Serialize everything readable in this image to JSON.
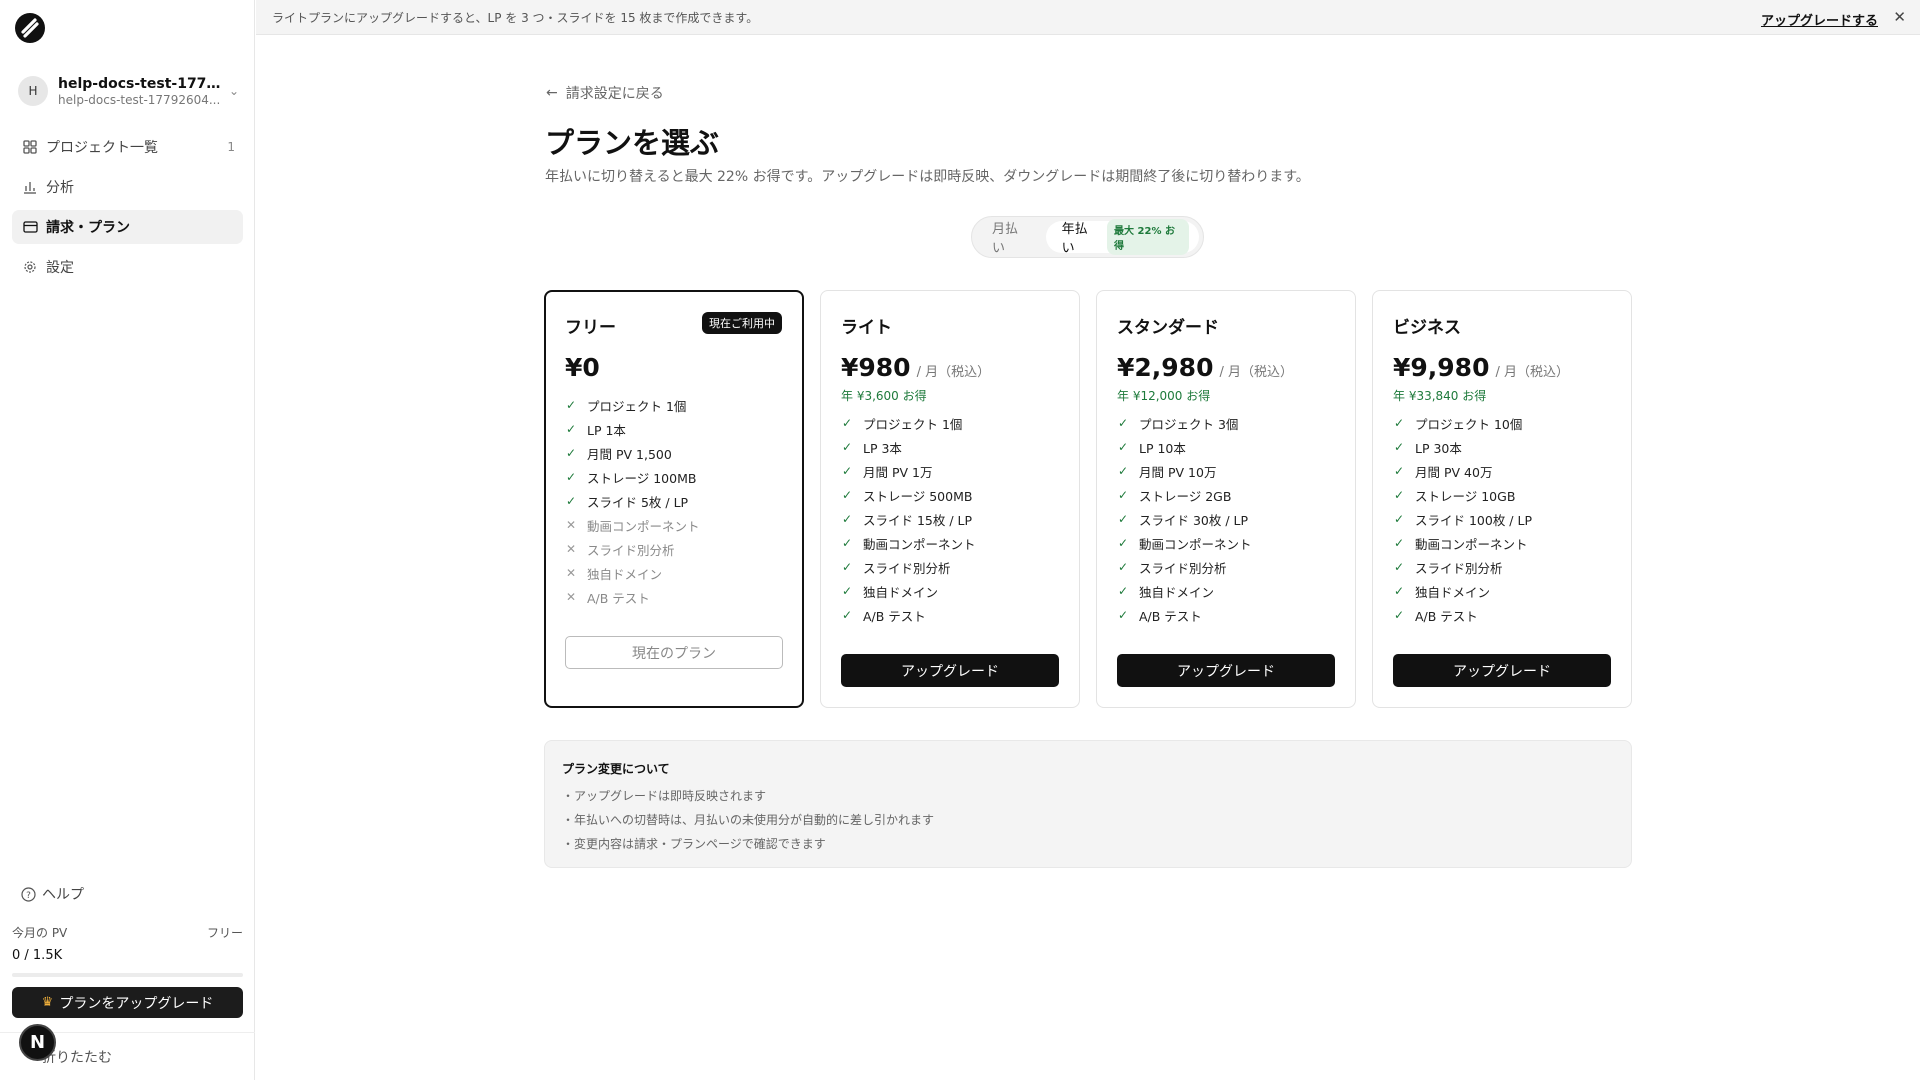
{
  "banner": {
    "message": "ライトプランにアップグレードすると、LP を 3 つ・スライドを 15 枚まで作成できます。",
    "link": "アップグレードする"
  },
  "sidebar": {
    "account": {
      "initial": "H",
      "name": "help-docs-test-17792...",
      "sub": "help-docs-test-17792604..."
    },
    "items": [
      {
        "label": "プロジェクト一覧",
        "icon": "grid-icon",
        "count": "1"
      },
      {
        "label": "分析",
        "icon": "bar-chart-icon"
      },
      {
        "label": "請求・プラン",
        "icon": "credit-card-icon",
        "active": true
      },
      {
        "label": "設定",
        "icon": "gear-icon"
      }
    ],
    "help": "ヘルプ",
    "pv_label": "今月の PV",
    "plan_label": "フリー",
    "pv_value": "0 / 1.5K",
    "pv_progress": 0,
    "upgrade_label": "プランをアップグレード",
    "collapse_label": "折りたたむ",
    "badge_letter": "N"
  },
  "main": {
    "back_label": "請求設定に戻る",
    "title": "プランを選ぶ",
    "subtitle": "年払いに切り替えると最大 22% お得です。アップグレードは即時反映、ダウングレードは期間終了後に切り替わります。",
    "toggle": {
      "monthly": "月払い",
      "yearly": "年払い",
      "badge": "最大 22% お得",
      "selected": "yearly"
    },
    "plans": [
      {
        "name": "フリー",
        "badge": "現在ご利用中",
        "price": "¥0",
        "features": [
          {
            "text": "プロジェクト 1個",
            "on": true
          },
          {
            "text": "LP 1本",
            "on": true
          },
          {
            "text": "月間 PV 1,500",
            "on": true
          },
          {
            "text": "ストレージ 100MB",
            "on": true
          },
          {
            "text": "スライド 5枚 / LP",
            "on": true
          },
          {
            "text": "動画コンポーネント",
            "on": false
          },
          {
            "text": "スライド別分析",
            "on": false
          },
          {
            "text": "独自ドメイン",
            "on": false
          },
          {
            "text": "A/B テスト",
            "on": false
          }
        ],
        "button": "現在のプラン"
      },
      {
        "name": "ライト",
        "price": "¥980",
        "unit": "/ 月（税込）",
        "save": "年 ¥3,600 お得",
        "features": [
          {
            "text": "プロジェクト 1個",
            "on": true
          },
          {
            "text": "LP 3本",
            "on": true
          },
          {
            "text": "月間 PV 1万",
            "on": true
          },
          {
            "text": "ストレージ 500MB",
            "on": true
          },
          {
            "text": "スライド 15枚 / LP",
            "on": true
          },
          {
            "text": "動画コンポーネント",
            "on": true
          },
          {
            "text": "スライド別分析",
            "on": true
          },
          {
            "text": "独自ドメイン",
            "on": true
          },
          {
            "text": "A/B テスト",
            "on": true
          }
        ],
        "button": "アップグレード"
      },
      {
        "name": "スタンダード",
        "price": "¥2,980",
        "unit": "/ 月（税込）",
        "save": "年 ¥12,000 お得",
        "features": [
          {
            "text": "プロジェクト 3個",
            "on": true
          },
          {
            "text": "LP 10本",
            "on": true
          },
          {
            "text": "月間 PV 10万",
            "on": true
          },
          {
            "text": "ストレージ 2GB",
            "on": true
          },
          {
            "text": "スライド 30枚 / LP",
            "on": true
          },
          {
            "text": "動画コンポーネント",
            "on": true
          },
          {
            "text": "スライド別分析",
            "on": true
          },
          {
            "text": "独自ドメイン",
            "on": true
          },
          {
            "text": "A/B テスト",
            "on": true
          }
        ],
        "button": "アップグレード"
      },
      {
        "name": "ビジネス",
        "price": "¥9,980",
        "unit": "/ 月（税込）",
        "save": "年 ¥33,840 お得",
        "features": [
          {
            "text": "プロジェクト 10個",
            "on": true
          },
          {
            "text": "LP 30本",
            "on": true
          },
          {
            "text": "月間 PV 40万",
            "on": true
          },
          {
            "text": "ストレージ 10GB",
            "on": true
          },
          {
            "text": "スライド 100枚 / LP",
            "on": true
          },
          {
            "text": "動画コンポーネント",
            "on": true
          },
          {
            "text": "スライド別分析",
            "on": true
          },
          {
            "text": "独自ドメイン",
            "on": true
          },
          {
            "text": "A/B テスト",
            "on": true
          }
        ],
        "button": "アップグレード"
      }
    ],
    "notes": {
      "title": "プラン変更について",
      "items": [
        "・アップグレードは即時反映されます",
        "・年払いへの切替時は、月払いの未使用分が自動的に差し引かれます",
        "・変更内容は請求・プランページで確認できます"
      ]
    }
  }
}
